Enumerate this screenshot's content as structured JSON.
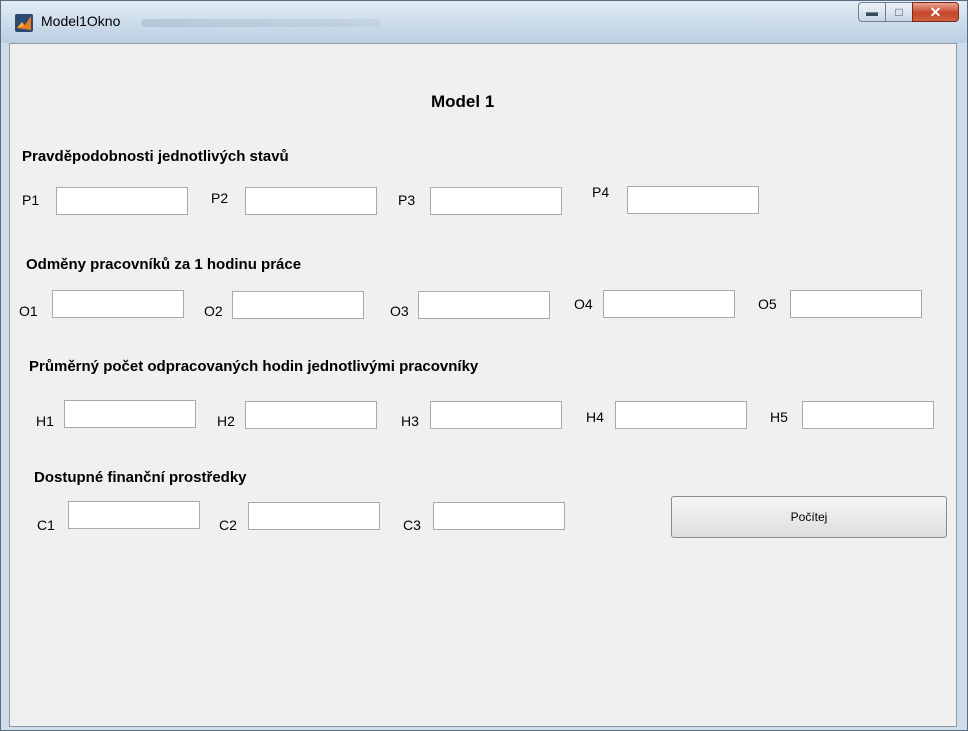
{
  "window": {
    "title": "Model1Okno",
    "minimize_icon": "minimize-icon",
    "maximize_icon": "maximize-icon",
    "close_icon": "close-icon",
    "app_icon": "matlab-icon"
  },
  "main": {
    "heading": "Model 1",
    "sections": {
      "probabilities": {
        "title": "Pravděpodobnosti jednotlivých stavů",
        "labels": [
          "P1",
          "P2",
          "P3",
          "P4"
        ],
        "values": [
          "",
          "",
          "",
          ""
        ]
      },
      "wages": {
        "title": "Odměny pracovníků za 1 hodinu práce",
        "labels": [
          "O1",
          "O2",
          "O3",
          "O4",
          "O5"
        ],
        "values": [
          "",
          "",
          "",
          "",
          ""
        ]
      },
      "hours": {
        "title": "Průměrný počet odpracovaných hodin jednotlivými pracovníky",
        "labels": [
          "H1",
          "H2",
          "H3",
          "H4",
          "H5"
        ],
        "values": [
          "",
          "",
          "",
          "",
          ""
        ]
      },
      "funds": {
        "title": "Dostupné finanční prostředky",
        "labels": [
          "C1",
          "C2",
          "C3"
        ],
        "values": [
          "",
          "",
          ""
        ]
      }
    },
    "compute_button": "Počítej"
  },
  "colors": {
    "client_bg": "#f0f0f0",
    "titlebar": "#cfdeec",
    "close_button": "#c7452b"
  }
}
